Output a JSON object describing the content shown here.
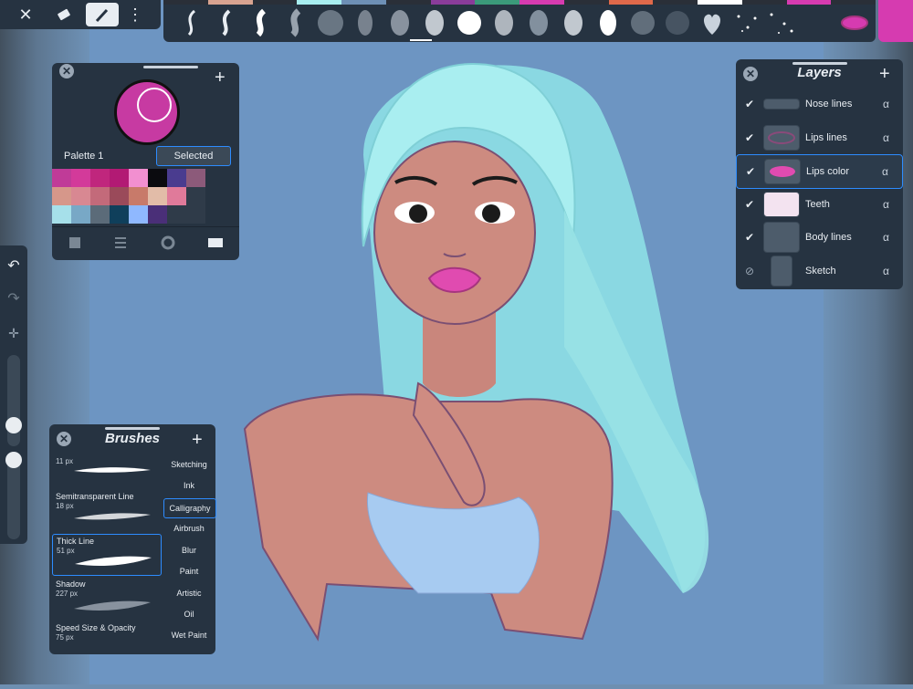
{
  "toolbar": {
    "close_icon": "close-icon",
    "eraser_icon": "eraser-icon",
    "brush_icon": "brush-icon",
    "more_icon": "more-vertical-icon"
  },
  "colors": {
    "current": "#d63bb0",
    "panel": "#263341",
    "accent": "#2d8cff"
  },
  "color_panel": {
    "palette_name": "Palette 1",
    "selected_label": "Selected",
    "current_color": "#c73aa2",
    "swatches": [
      "#c03b98",
      "#d33a9a",
      "#c0267d",
      "#b21a74",
      "#f28fd0",
      "#0b0b0f",
      "#4a3c8f",
      "#8c5a7a",
      "#d6978a",
      "#d88892",
      "#c36a7a",
      "#9a4a5a",
      "#c87a6a",
      "#e2bca8",
      "#e07a9a",
      "#2f3b49",
      "#a6e0ea",
      "#78a8c6",
      "#5b6b79",
      "#0f3f5b",
      "#8fb8ff",
      "#4a2f78",
      "#2f3b49",
      "#2f3b49"
    ],
    "bottom_icons": [
      "square-icon",
      "list-icon",
      "wheel-icon",
      "grid-icon"
    ]
  },
  "layers": {
    "title": "Layers",
    "items": [
      {
        "name": "Nose lines",
        "visible": true
      },
      {
        "name": "Lips lines",
        "visible": true
      },
      {
        "name": "Lips color",
        "visible": true,
        "selected": true
      },
      {
        "name": "Teeth",
        "visible": true
      },
      {
        "name": "Body lines",
        "visible": true
      },
      {
        "name": "Sketch",
        "visible": false
      }
    ],
    "alpha_label": "α"
  },
  "brushes": {
    "title": "Brushes",
    "items": [
      {
        "name": "",
        "size": "11 px"
      },
      {
        "name": "Semitransparent Line",
        "size": "18 px"
      },
      {
        "name": "Thick Line",
        "size": "51 px"
      },
      {
        "name": "Shadow",
        "size": "227 px"
      },
      {
        "name": "Speed Size & Opacity",
        "size": "75 px"
      }
    ],
    "categories": [
      "Sketching",
      "Ink",
      "Calligraphy",
      "Airbrush",
      "Blur",
      "Paint",
      "Artistic",
      "Oil",
      "Wet Paint"
    ],
    "selected_category": "Calligraphy"
  },
  "sidebar": {
    "icons": [
      "undo-icon",
      "redo-icon",
      "transform-icon"
    ]
  }
}
